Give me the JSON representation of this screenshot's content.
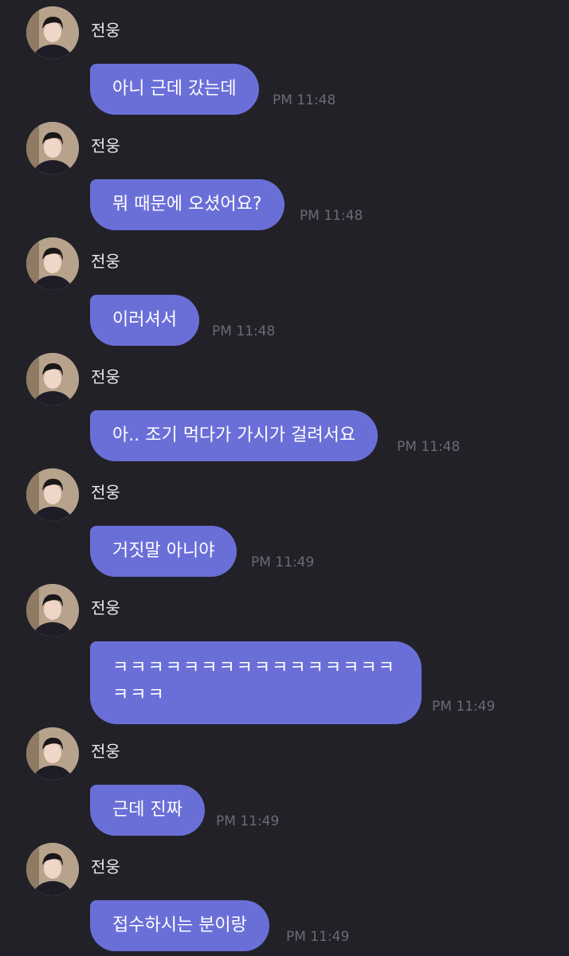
{
  "sender_name": "전웅",
  "messages": [
    {
      "text": "아니 근데 갔는데",
      "time": "PM 11:48"
    },
    {
      "text": "뭐 때문에 오셨어요?",
      "time": "PM 11:48"
    },
    {
      "text": "이러셔서",
      "time": "PM 11:48"
    },
    {
      "text": "아.. 조기 먹다가 가시가 걸려서요",
      "time": "PM 11:48"
    },
    {
      "text": "거짓말 아니야",
      "time": "PM 11:49"
    },
    {
      "text": "ㅋㅋㅋㅋㅋㅋㅋㅋㅋㅋㅋㅋㅋㅋㅋㅋㅋㅋㅋ",
      "time": "PM 11:49"
    },
    {
      "text": "근데 진짜",
      "time": "PM 11:49"
    },
    {
      "text": "접수하시는 분이랑",
      "time": "PM 11:49"
    }
  ]
}
